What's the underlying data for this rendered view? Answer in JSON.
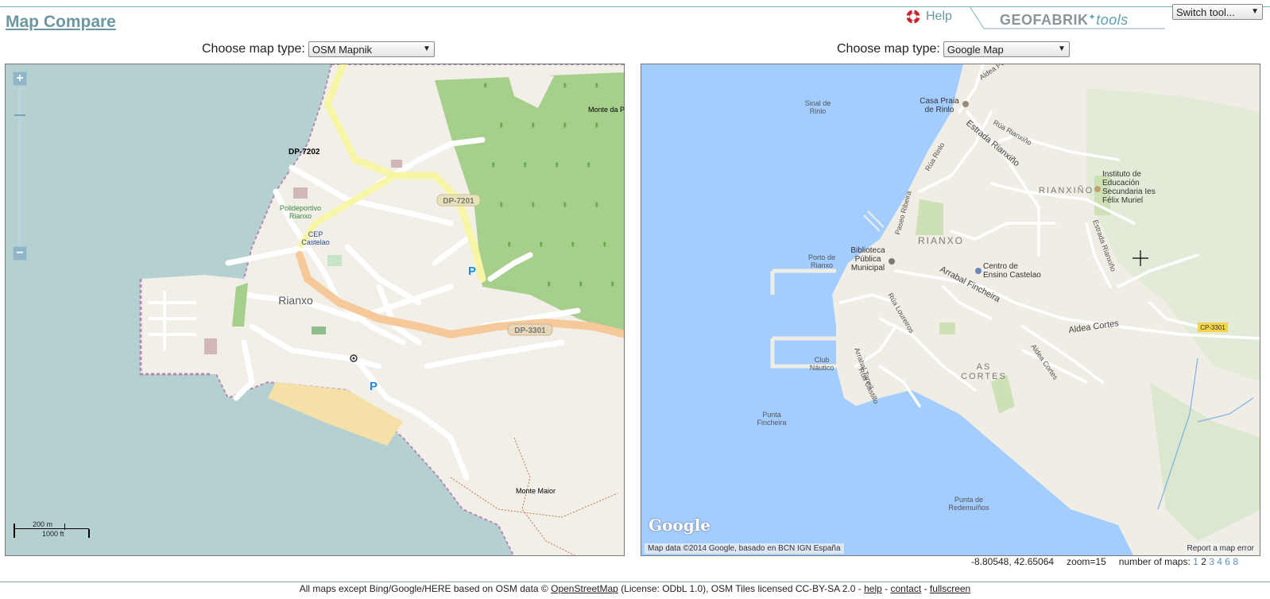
{
  "header": {
    "title": "Map Compare",
    "help_label": "Help",
    "logo_main": "GEOFABRIK",
    "logo_suffix": "tools",
    "switch_tool": "Switch tool..."
  },
  "left_panel": {
    "choose_label": "Choose map type:",
    "selected_map": "OSM Mapnik",
    "labels": {
      "dp7202": "DP-7202",
      "dp7201": "DP-7201",
      "dp3301": "DP-3301",
      "polideportivo1": "Polideportivo",
      "polideportivo2": "Rianxo",
      "cep1": "CEP",
      "cep2": "Castelao",
      "rianxo": "Rianxo",
      "monte_maior": "Monte Maior",
      "monte_da": "Monte da Pe",
      "parking": "P"
    },
    "scale_m": "200 m",
    "scale_ft": "1000 ft"
  },
  "right_panel": {
    "choose_label": "Choose map type:",
    "selected_map": "Google Map",
    "labels": {
      "sinal1": "Sinal de",
      "sinal2": "Rinlo",
      "casa1": "Casa Praia",
      "casa2": "de Rinlo",
      "aldea_paz": "Aldea Paz",
      "estrada_rianxino": "Estrada Rianxiño",
      "rua_rianxino": "Rúa Rianxiño",
      "rua_rinlo": "Rúa Rinlo",
      "rianxino": "RIANXIÑO",
      "instituto1": "Instituto de",
      "instituto2": "Educación",
      "instituto3": "Secundaria Ies",
      "instituto4": "Félix Muriel",
      "paseo": "Paseo Ribeira",
      "rianxo": "RIANXO",
      "porto1": "Porto de",
      "porto2": "Rianxo",
      "biblio1": "Biblioteca",
      "biblio2": "Pública",
      "biblio3": "Municipal",
      "centro1": "Centro de",
      "centro2": "Ensino Castelao",
      "estrada_rianxino2": "Estrada Rianxiño",
      "arrabal": "Arrabal Fincheira",
      "rua_loureiros": "Rúa Loureiros",
      "aldea_cortes": "Aldea Cortes",
      "aldea_cortes2": "Aldea Cortes",
      "cp3301": "CP-3301",
      "arrabal_tanxil": "Arrabal Tanxil",
      "rua_castillo": "Rúa Castillo",
      "club1": "Club",
      "club2": "Náutico",
      "as_cortes1": "AS",
      "as_cortes2": "CORTES",
      "punta1": "Punta",
      "punta2": "Fincheira",
      "redem1": "Punta de",
      "redem2": "Redemuíños"
    },
    "google_logo": "Google",
    "attribution": "Map data ©2014 Google, basado en BCN IGN España",
    "report": "Report a map error"
  },
  "status": {
    "coords": "-8.80548, 42.65064",
    "zoom": "zoom=15",
    "number_label": "number of maps:",
    "n1": "1",
    "n2": "2",
    "n3": "3",
    "n4": "4",
    "n6": "6",
    "n8": "8"
  },
  "footer": {
    "text1": "All maps except Bing/Google/HERE based on OSM data ©",
    "osm_link": "OpenStreetMap",
    "text2": "(License: ODbL 1.0), OSM Tiles licensed CC-BY-SA 2.0 -",
    "help": "help",
    "sep1": "-",
    "contact": "contact",
    "sep2": "-",
    "fullscreen": "fullscreen"
  },
  "colors": {
    "accent": "#6b97a0",
    "osm_sea": "#b5d0d0",
    "osm_land": "#f2efe9",
    "osm_forest": "#a5cf8a",
    "google_sea": "#a3ccff",
    "google_land": "#f0ede5"
  }
}
